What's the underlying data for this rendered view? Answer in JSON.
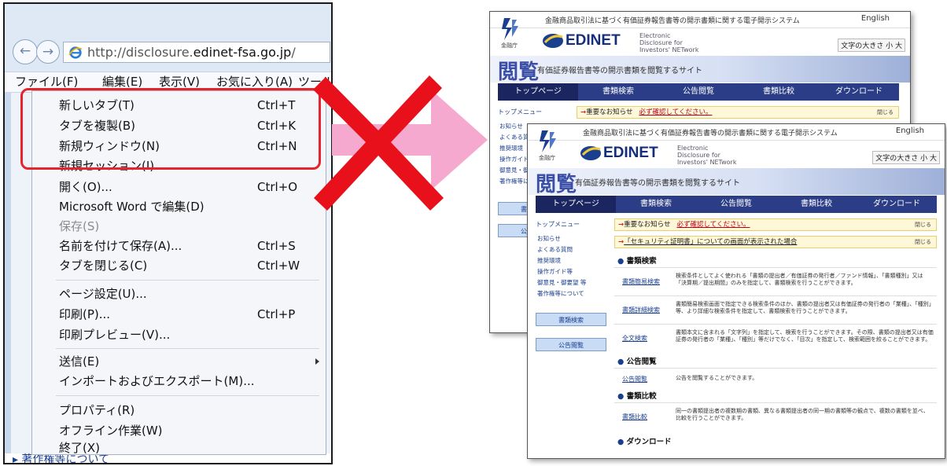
{
  "browser": {
    "address_prefix": "http://disclosure.",
    "address_domain": "edinet-fsa.go.jp",
    "address_suffix": "/",
    "menubar": [
      "ファイル(F)",
      "編集(E)",
      "表示(V)",
      "お気に入り(A)",
      "ツール"
    ],
    "background_link": "著作権等について"
  },
  "file_menu": {
    "items": [
      {
        "label": "新しいタブ(T)",
        "shortcut": "Ctrl+T"
      },
      {
        "label": "タブを複製(B)",
        "shortcut": "Ctrl+K"
      },
      {
        "label": "新規ウィンドウ(N)",
        "shortcut": "Ctrl+N"
      },
      {
        "label": "新規セッション(I)",
        "shortcut": ""
      },
      {
        "label": "開く(O)...",
        "shortcut": "Ctrl+O"
      },
      {
        "label": "Microsoft Word で編集(D)",
        "shortcut": ""
      },
      {
        "label": "保存(S)",
        "shortcut": "",
        "disabled": true
      },
      {
        "label": "名前を付けて保存(A)...",
        "shortcut": "Ctrl+S"
      },
      {
        "label": "タブを閉じる(C)",
        "shortcut": "Ctrl+W"
      },
      {
        "label": "ページ設定(U)...",
        "shortcut": ""
      },
      {
        "label": "印刷(P)...",
        "shortcut": "Ctrl+P"
      },
      {
        "label": "印刷プレビュー(V)...",
        "shortcut": ""
      },
      {
        "label": "送信(E)",
        "shortcut": "",
        "submenu": true
      },
      {
        "label": "インポートおよびエクスポート(M)...",
        "shortcut": ""
      },
      {
        "label": "プロパティ(R)",
        "shortcut": ""
      },
      {
        "label": "オフライン作業(W)",
        "shortcut": ""
      },
      {
        "label": "終了(X)",
        "shortcut": ""
      }
    ]
  },
  "edinet": {
    "top_line": "金融商品取引法に基づく有価証券報告書等の開示書類に関する電子開示システム",
    "english": "English",
    "fsa_label": "金融庁",
    "brand": "EDINET",
    "brand_sub": "Electronic Disclosure for Investors' NETwork",
    "font_size": "文字の大きさ 小 大",
    "etsuran": "閲覧",
    "etsuran_sub": "有価証券報告書等の開示書類を閲覧するサイト",
    "nav": [
      "トップページ",
      "書類検索",
      "公告閲覧",
      "書類比較",
      "ダウンロード"
    ],
    "sidebar_title": "トップメニュー",
    "sidebar_links": [
      "お知らせ",
      "よくある質問",
      "推奨環境",
      "操作ガイド等",
      "御意見・御要望 等",
      "著作権等について"
    ],
    "sidebar_buttons": [
      "書類検索",
      "公告閲覧"
    ],
    "notices": [
      {
        "prefix": "重要なお知らせ",
        "link": "必ず確認してください。",
        "right": "閉じる"
      },
      {
        "prefix": "「セキュリティ証明書」についての画面が表示された場合",
        "link": "",
        "right": "閉じる"
      }
    ],
    "sections": [
      {
        "title": "書類検索",
        "rows": [
          {
            "link": "書類簡易検索",
            "desc": "検索条件としてよく使われる「書類の提出者／有価証券の発行者／ファンド情報」、「書類種別」又は「決算期／提出期間」のみを指定して、書類検索を行うことができます。"
          },
          {
            "link": "書類詳細検索",
            "desc": "書類簡易検索画面で指定できる検索条件のほか、書類の提出者又は有価証券の発行者の「業種」、「種別」等、より詳細な検索条件を指定して、書類検索を行うことができます。"
          },
          {
            "link": "全文検索",
            "desc": "書類本文に含まれる「文字列」を指定して、検索を行うことができます。その際、書類の提出者又は有価証券の発行者の「業種」、「種別」等だけでなく、「目次」を指定して、検索範囲を絞ることができます。"
          }
        ]
      },
      {
        "title": "公告閲覧",
        "rows": [
          {
            "link": "公告閲覧",
            "desc": "公告を閲覧することができます。"
          }
        ]
      },
      {
        "title": "書類比較",
        "rows": [
          {
            "link": "書類比較",
            "desc": "同一の書類提出者の複数期の書類、異なる書類提出者の同一期の書類等の観点で、複数の書類を並べ、比較を行うことができます。"
          }
        ]
      },
      {
        "title": "ダウンロード",
        "rows": []
      }
    ]
  },
  "colors": {
    "highlight": "#e5242d",
    "cross": "#e8111b",
    "arrow": "#f6a9cf",
    "nav": "#2b3d86"
  }
}
